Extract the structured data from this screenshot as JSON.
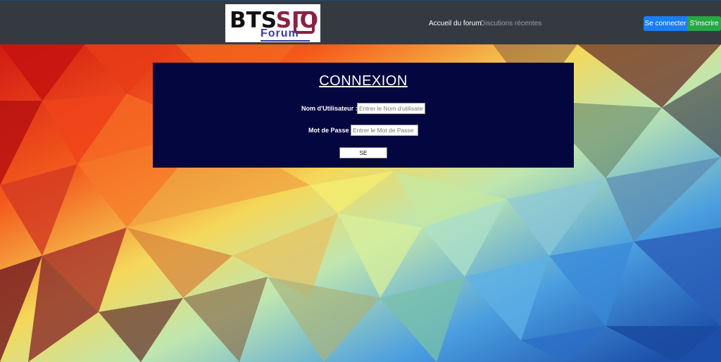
{
  "navbar": {
    "logo": {
      "part1": "BTS",
      "part2": "SIO",
      "part3": "Forum"
    },
    "links": [
      {
        "label": "Accueil du forum"
      },
      {
        "label": "Discutions récentes"
      }
    ],
    "buttons": {
      "login": "Se connecter",
      "signup": "S'inscrire"
    },
    "colors": {
      "background": "#343a40",
      "login": "#1a7ef5",
      "signup": "#28a745"
    }
  },
  "login_form": {
    "title": "CONNEXION",
    "username_label": "Nom d'Utilisateur :",
    "username_placeholder": "Entrer le Nom d'utilisateur",
    "password_label": "Mot de Passe :",
    "password_placeholder": "Entrer le Mot de Passe",
    "submit_label": "SE CONNECTER",
    "colors": {
      "panel": "#03063f"
    }
  }
}
